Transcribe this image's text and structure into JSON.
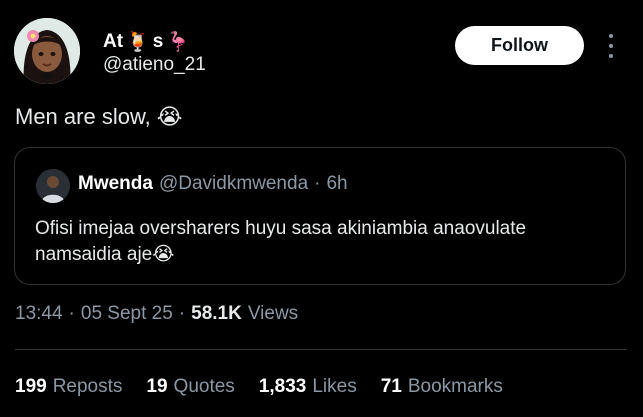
{
  "author": {
    "name": "At",
    "emoji_1": "🍹",
    "name_suffix": "s",
    "emoji_2": "🦩",
    "handle": "@atieno_21"
  },
  "actions": {
    "follow_label": "Follow"
  },
  "tweet": {
    "text": "Men are slow,",
    "emoji": "😭"
  },
  "quoted_tweet": {
    "name": "Mwenda",
    "handle": "@Davidkmwenda",
    "separator": "·",
    "time": "6h",
    "text": "Ofisi imejaa oversharers huyu sasa akiniambia anaovulate namsaidia aje😭"
  },
  "meta": {
    "time": "13:44",
    "separator": "·",
    "date": "05 Sept 25",
    "views_count": "58.1K",
    "views_label": "Views"
  },
  "stats": [
    {
      "count": "199",
      "label": "Reposts"
    },
    {
      "count": "19",
      "label": "Quotes"
    },
    {
      "count": "1,833",
      "label": "Likes"
    },
    {
      "count": "71",
      "label": "Bookmarks"
    }
  ]
}
